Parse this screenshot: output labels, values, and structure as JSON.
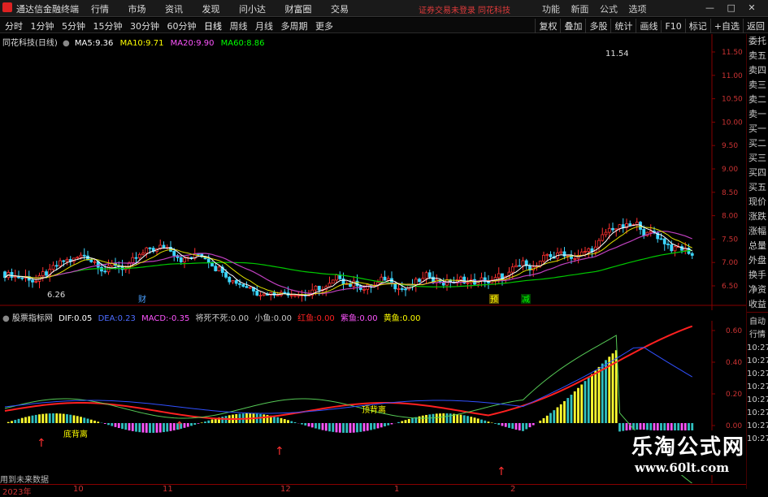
{
  "app": {
    "title": "通达信金融终端",
    "menu": [
      "行情",
      "市场",
      "资讯",
      "发现",
      "问小达",
      "财富圈",
      "交易"
    ],
    "notice": "证券交易未登录",
    "stock_title": "同花科技",
    "right_menu": [
      "功能",
      "新面",
      "公式",
      "选项"
    ],
    "win_controls": [
      "—",
      "□",
      "✕"
    ]
  },
  "toolbar": {
    "periods": [
      "分时",
      "1分钟",
      "5分钟",
      "15分钟",
      "30分钟",
      "60分钟",
      "日线",
      "周线",
      "月线",
      "多周期",
      "更多"
    ],
    "active": "日线",
    "right": [
      "复权",
      "叠加",
      "多股",
      "统计",
      "画线",
      "F10",
      "标记",
      "+自选",
      "返回"
    ]
  },
  "main": {
    "stock_label": "同花科技(日线)",
    "ma": [
      {
        "name": "MA5",
        "value": "9.36",
        "color": "#ffffff"
      },
      {
        "name": "MA10",
        "value": "9.71",
        "color": "#ffff00"
      },
      {
        "name": "MA20",
        "value": "9.90",
        "color": "#ff55ff"
      },
      {
        "name": "MA60",
        "value": "8.86",
        "color": "#00ff00"
      }
    ],
    "y_labels": [
      "11.50",
      "11.00",
      "10.50",
      "10.00",
      "9.50",
      "9.00",
      "8.50",
      "8.00",
      "7.50",
      "7.00",
      "6.50"
    ],
    "high_label": "11.54",
    "low_label": "6.26",
    "events": [
      {
        "text": "财",
        "color": "#4aa0ff"
      },
      {
        "text": "预",
        "color": "#ffff00"
      },
      {
        "text": "减",
        "color": "#00ff00"
      }
    ]
  },
  "sub": {
    "indicator": "股票指标网",
    "items": [
      {
        "name": "DIF:",
        "value": "0.05",
        "color": "#ffffff"
      },
      {
        "name": "DEA:",
        "value": "0.23",
        "color": "#4d6cff"
      },
      {
        "name": "MACD:",
        "value": "-0.35",
        "color": "#ff55ff"
      },
      {
        "name": "将死不死:",
        "value": "0.00",
        "color": "#cccccc"
      },
      {
        "name": "小鱼:",
        "value": "0.00",
        "color": "#cccccc"
      },
      {
        "name": "红鱼:",
        "value": "0.00",
        "color": "#ff2222"
      },
      {
        "name": "紫鱼:",
        "value": "0.00",
        "color": "#ff55ff"
      },
      {
        "name": "黄鱼:",
        "value": "0.00",
        "color": "#ffff00"
      }
    ],
    "y_labels": [
      "0.60",
      "0.40",
      "0.20",
      "0.00"
    ],
    "markers": [
      "底背离",
      "顶背离"
    ]
  },
  "bottom": {
    "note": "用到未来数据",
    "dates": [
      "2023年",
      "10",
      "11",
      "12",
      "1",
      "2"
    ]
  },
  "side": {
    "items": [
      "委托",
      "卖五",
      "卖四",
      "卖三",
      "卖二",
      "卖一",
      "买一",
      "买二",
      "买三",
      "买四",
      "买五",
      "现价",
      "涨跌",
      "涨幅",
      "总量",
      "外盘",
      "换手",
      "净资",
      "收益"
    ],
    "items2": [
      "自动",
      "行情",
      "10:27",
      "10:27",
      "10:27",
      "10:27",
      "10:27",
      "10:27",
      "10:27",
      "10:27"
    ]
  },
  "watermark": {
    "line1": "乐淘公式网",
    "line2": "www.60lt.com"
  }
}
